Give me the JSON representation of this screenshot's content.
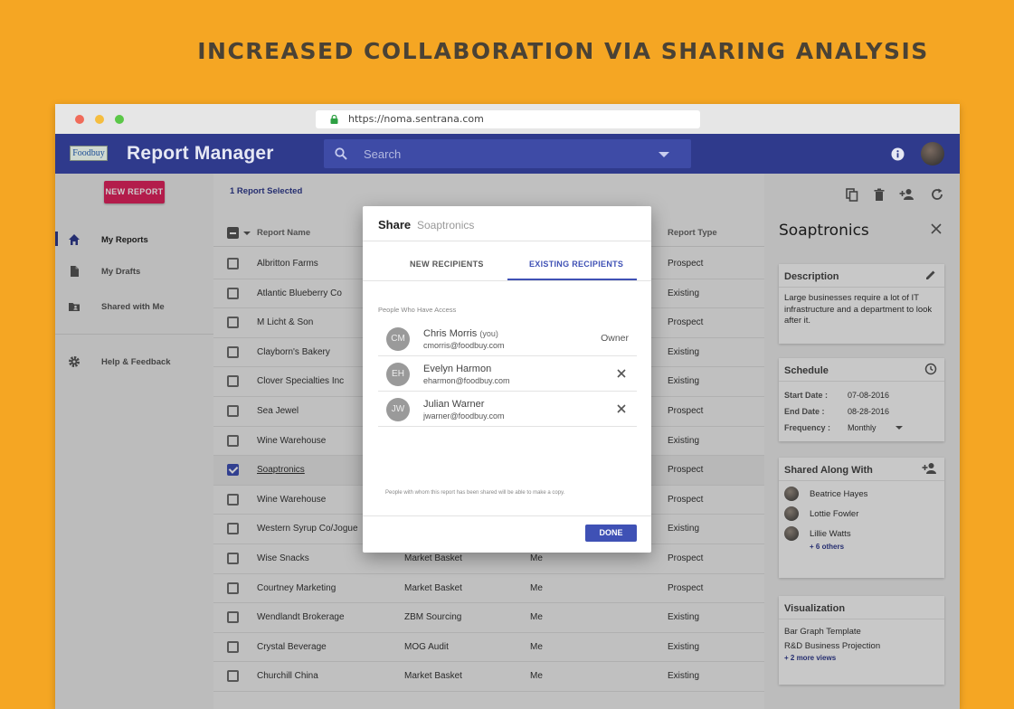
{
  "headline": "INCREASED COLLABORATION VIA SHARING ANALYSIS",
  "browser": {
    "url": "https://noma.sentrana.com"
  },
  "appbar": {
    "logo": "Foodbuy",
    "title": "Report Manager",
    "search_placeholder": "Search"
  },
  "sidebar": {
    "new_report": "NEW REPORT",
    "items": [
      {
        "label": "My Reports",
        "icon": "home-icon",
        "active": true
      },
      {
        "label": "My Drafts",
        "icon": "document-icon",
        "active": false
      },
      {
        "label": "Shared with Me",
        "icon": "shared-folder-icon",
        "active": false
      },
      {
        "label": "Help & Feedback",
        "icon": "gear-icon",
        "active": false
      }
    ]
  },
  "main": {
    "selected_label": "1 Report Selected",
    "columns": [
      "Report Name",
      "",
      "",
      "Report Type"
    ],
    "rows": [
      {
        "name": "Albritton Farms",
        "col2": "",
        "col3": "",
        "type": "Prospect",
        "checked": false
      },
      {
        "name": "Atlantic Blueberry Co",
        "col2": "",
        "col3": "",
        "type": "Existing",
        "checked": false
      },
      {
        "name": "M Licht & Son",
        "col2": "",
        "col3": "",
        "type": "Prospect",
        "checked": false
      },
      {
        "name": "Clayborn's Bakery",
        "col2": "",
        "col3": "",
        "type": "Existing",
        "checked": false
      },
      {
        "name": "Clover Specialties Inc",
        "col2": "",
        "col3": "",
        "type": "Existing",
        "checked": false
      },
      {
        "name": "Sea Jewel",
        "col2": "",
        "col3": "",
        "type": "Prospect",
        "checked": false
      },
      {
        "name": "Wine Warehouse",
        "col2": "",
        "col3": "",
        "type": "Existing",
        "checked": false
      },
      {
        "name": "Soaptronics",
        "col2": "",
        "col3": "",
        "type": "Prospect",
        "checked": true
      },
      {
        "name": "Wine Warehouse",
        "col2": "",
        "col3": "",
        "type": "Prospect",
        "checked": false
      },
      {
        "name": "Western Syrup Co/Jogue",
        "col2": "",
        "col3": "",
        "type": "Existing",
        "checked": false
      },
      {
        "name": "Wise Snacks",
        "col2": "Market Basket",
        "col3": "Me",
        "type": "Prospect",
        "checked": false
      },
      {
        "name": "Courtney Marketing",
        "col2": "Market Basket",
        "col3": "Me",
        "type": "Prospect",
        "checked": false
      },
      {
        "name": "Wendlandt Brokerage",
        "col2": "ZBM Sourcing",
        "col3": "Me",
        "type": "Existing",
        "checked": false
      },
      {
        "name": "Crystal Beverage",
        "col2": "MOG Audit",
        "col3": "Me",
        "type": "Existing",
        "checked": false
      },
      {
        "name": "Churchill China",
        "col2": "Market Basket",
        "col3": "Me",
        "type": "Existing",
        "checked": false
      }
    ]
  },
  "detail": {
    "title": "Soaptronics",
    "description": {
      "heading": "Description",
      "text": "Large businesses require a lot of IT infrastructure and a department to look after it."
    },
    "schedule": {
      "heading": "Schedule",
      "start_label": "Start Date :",
      "start_value": "07-08-2016",
      "end_label": "End Date  :",
      "end_value": "08-28-2016",
      "freq_label": "Frequency :",
      "freq_value": "Monthly"
    },
    "shared": {
      "heading": "Shared Along With",
      "people": [
        "Beatrice Hayes",
        "Lottie Fowler",
        "Lillie Watts"
      ],
      "more": "+ 6 others"
    },
    "visualization": {
      "heading": "Visualization",
      "items": [
        "Bar Graph Template",
        "R&D Business Projection"
      ],
      "more": "+ 2 more views"
    }
  },
  "modal": {
    "title": "Share",
    "subtitle": "Soaptronics",
    "tabs": [
      "NEW RECIPIENTS",
      "EXISTING RECIPIENTS"
    ],
    "section": "People Who Have Access",
    "recipients": [
      {
        "initials": "CM",
        "name": "Chris Morris",
        "you": "(you)",
        "email": "cmorris@foodbuy.com",
        "role": "Owner"
      },
      {
        "initials": "EH",
        "name": "Evelyn Harmon",
        "you": "",
        "email": "eharmon@foodbuy.com",
        "role": ""
      },
      {
        "initials": "JW",
        "name": "Julian Warner",
        "you": "",
        "email": "jwarner@foodbuy.com",
        "role": ""
      }
    ],
    "note": "People with whom this report has been shared will be able to make a copy.",
    "done": "DONE"
  }
}
